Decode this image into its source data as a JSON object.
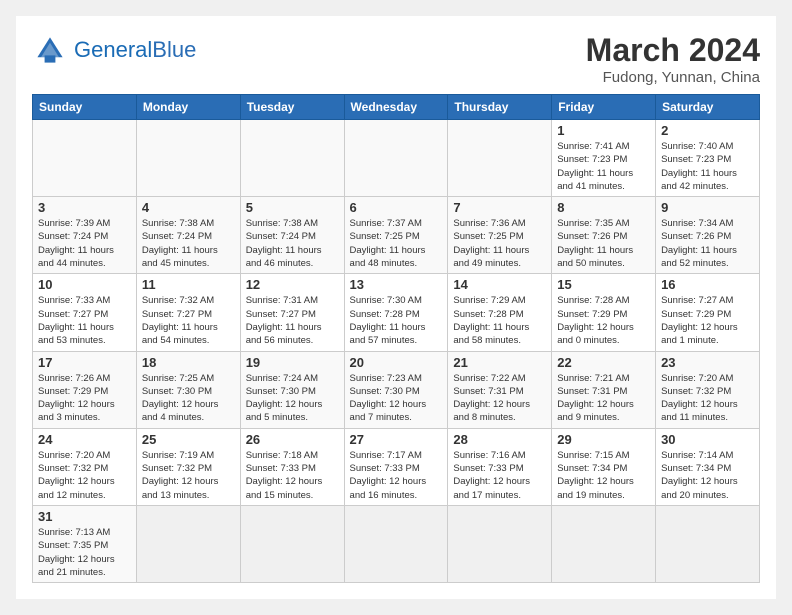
{
  "logo": {
    "text_general": "General",
    "text_blue": "Blue"
  },
  "header": {
    "month_year": "March 2024",
    "location": "Fudong, Yunnan, China"
  },
  "weekdays": [
    "Sunday",
    "Monday",
    "Tuesday",
    "Wednesday",
    "Thursday",
    "Friday",
    "Saturday"
  ],
  "weeks": [
    [
      {
        "day": "",
        "info": ""
      },
      {
        "day": "",
        "info": ""
      },
      {
        "day": "",
        "info": ""
      },
      {
        "day": "",
        "info": ""
      },
      {
        "day": "",
        "info": ""
      },
      {
        "day": "1",
        "info": "Sunrise: 7:41 AM\nSunset: 7:23 PM\nDaylight: 11 hours\nand 41 minutes."
      },
      {
        "day": "2",
        "info": "Sunrise: 7:40 AM\nSunset: 7:23 PM\nDaylight: 11 hours\nand 42 minutes."
      }
    ],
    [
      {
        "day": "3",
        "info": "Sunrise: 7:39 AM\nSunset: 7:24 PM\nDaylight: 11 hours\nand 44 minutes."
      },
      {
        "day": "4",
        "info": "Sunrise: 7:38 AM\nSunset: 7:24 PM\nDaylight: 11 hours\nand 45 minutes."
      },
      {
        "day": "5",
        "info": "Sunrise: 7:38 AM\nSunset: 7:24 PM\nDaylight: 11 hours\nand 46 minutes."
      },
      {
        "day": "6",
        "info": "Sunrise: 7:37 AM\nSunset: 7:25 PM\nDaylight: 11 hours\nand 48 minutes."
      },
      {
        "day": "7",
        "info": "Sunrise: 7:36 AM\nSunset: 7:25 PM\nDaylight: 11 hours\nand 49 minutes."
      },
      {
        "day": "8",
        "info": "Sunrise: 7:35 AM\nSunset: 7:26 PM\nDaylight: 11 hours\nand 50 minutes."
      },
      {
        "day": "9",
        "info": "Sunrise: 7:34 AM\nSunset: 7:26 PM\nDaylight: 11 hours\nand 52 minutes."
      }
    ],
    [
      {
        "day": "10",
        "info": "Sunrise: 7:33 AM\nSunset: 7:27 PM\nDaylight: 11 hours\nand 53 minutes."
      },
      {
        "day": "11",
        "info": "Sunrise: 7:32 AM\nSunset: 7:27 PM\nDaylight: 11 hours\nand 54 minutes."
      },
      {
        "day": "12",
        "info": "Sunrise: 7:31 AM\nSunset: 7:27 PM\nDaylight: 11 hours\nand 56 minutes."
      },
      {
        "day": "13",
        "info": "Sunrise: 7:30 AM\nSunset: 7:28 PM\nDaylight: 11 hours\nand 57 minutes."
      },
      {
        "day": "14",
        "info": "Sunrise: 7:29 AM\nSunset: 7:28 PM\nDaylight: 11 hours\nand 58 minutes."
      },
      {
        "day": "15",
        "info": "Sunrise: 7:28 AM\nSunset: 7:29 PM\nDaylight: 12 hours\nand 0 minutes."
      },
      {
        "day": "16",
        "info": "Sunrise: 7:27 AM\nSunset: 7:29 PM\nDaylight: 12 hours\nand 1 minute."
      }
    ],
    [
      {
        "day": "17",
        "info": "Sunrise: 7:26 AM\nSunset: 7:29 PM\nDaylight: 12 hours\nand 3 minutes."
      },
      {
        "day": "18",
        "info": "Sunrise: 7:25 AM\nSunset: 7:30 PM\nDaylight: 12 hours\nand 4 minutes."
      },
      {
        "day": "19",
        "info": "Sunrise: 7:24 AM\nSunset: 7:30 PM\nDaylight: 12 hours\nand 5 minutes."
      },
      {
        "day": "20",
        "info": "Sunrise: 7:23 AM\nSunset: 7:30 PM\nDaylight: 12 hours\nand 7 minutes."
      },
      {
        "day": "21",
        "info": "Sunrise: 7:22 AM\nSunset: 7:31 PM\nDaylight: 12 hours\nand 8 minutes."
      },
      {
        "day": "22",
        "info": "Sunrise: 7:21 AM\nSunset: 7:31 PM\nDaylight: 12 hours\nand 9 minutes."
      },
      {
        "day": "23",
        "info": "Sunrise: 7:20 AM\nSunset: 7:32 PM\nDaylight: 12 hours\nand 11 minutes."
      }
    ],
    [
      {
        "day": "24",
        "info": "Sunrise: 7:20 AM\nSunset: 7:32 PM\nDaylight: 12 hours\nand 12 minutes."
      },
      {
        "day": "25",
        "info": "Sunrise: 7:19 AM\nSunset: 7:32 PM\nDaylight: 12 hours\nand 13 minutes."
      },
      {
        "day": "26",
        "info": "Sunrise: 7:18 AM\nSunset: 7:33 PM\nDaylight: 12 hours\nand 15 minutes."
      },
      {
        "day": "27",
        "info": "Sunrise: 7:17 AM\nSunset: 7:33 PM\nDaylight: 12 hours\nand 16 minutes."
      },
      {
        "day": "28",
        "info": "Sunrise: 7:16 AM\nSunset: 7:33 PM\nDaylight: 12 hours\nand 17 minutes."
      },
      {
        "day": "29",
        "info": "Sunrise: 7:15 AM\nSunset: 7:34 PM\nDaylight: 12 hours\nand 19 minutes."
      },
      {
        "day": "30",
        "info": "Sunrise: 7:14 AM\nSunset: 7:34 PM\nDaylight: 12 hours\nand 20 minutes."
      }
    ],
    [
      {
        "day": "31",
        "info": "Sunrise: 7:13 AM\nSunset: 7:35 PM\nDaylight: 12 hours\nand 21 minutes."
      },
      {
        "day": "",
        "info": ""
      },
      {
        "day": "",
        "info": ""
      },
      {
        "day": "",
        "info": ""
      },
      {
        "day": "",
        "info": ""
      },
      {
        "day": "",
        "info": ""
      },
      {
        "day": "",
        "info": ""
      }
    ]
  ]
}
